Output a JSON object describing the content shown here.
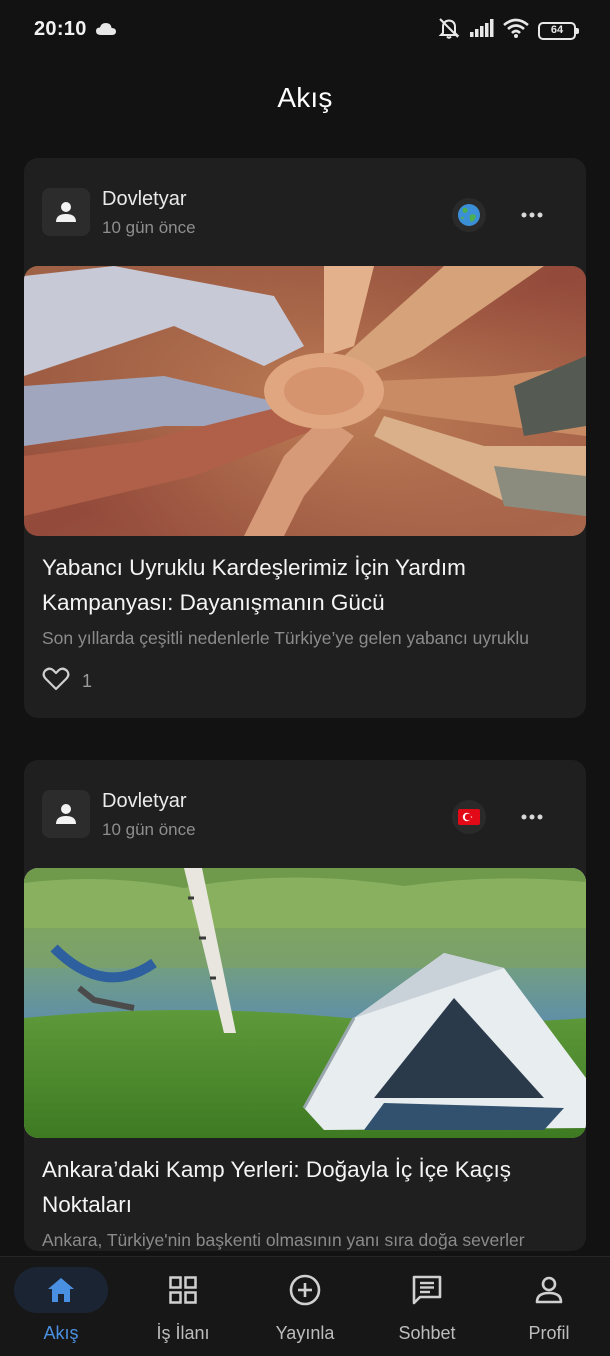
{
  "status_bar": {
    "time": "20:10",
    "battery": "64"
  },
  "header": {
    "title": "Akış"
  },
  "posts": [
    {
      "author": "Dovletyar",
      "time": "10 gün önce",
      "flag_icon": "globe-icon",
      "title": "Yabancı Uyruklu Kardeşlerimiz İçin Yardım Kampanyası: Dayanışmanın Gücü",
      "excerpt": "Son yıllarda çeşitli nedenlerle Türkiye’ye gelen yabancı uyruklu",
      "likes": "1"
    },
    {
      "author": "Dovletyar",
      "time": "10 gün önce",
      "flag_icon": "turkey-flag-icon",
      "title": "Ankara’daki Kamp Yerleri: Doğayla İç İçe Kaçış Noktaları",
      "excerpt": "Ankara, Türkiye'nin başkenti olmasının yanı sıra doğa severler"
    }
  ],
  "nav": {
    "items": [
      {
        "label": "Akış",
        "icon": "home-icon",
        "active": true
      },
      {
        "label": "İş İlanı",
        "icon": "grid-icon",
        "active": false
      },
      {
        "label": "Yayınla",
        "icon": "add-circle-icon",
        "active": false
      },
      {
        "label": "Sohbet",
        "icon": "chat-icon",
        "active": false
      },
      {
        "label": "Profil",
        "icon": "profile-icon",
        "active": false
      }
    ]
  },
  "colors": {
    "accent": "#4a90e2",
    "background": "#121212",
    "card": "#1f1f1f"
  }
}
